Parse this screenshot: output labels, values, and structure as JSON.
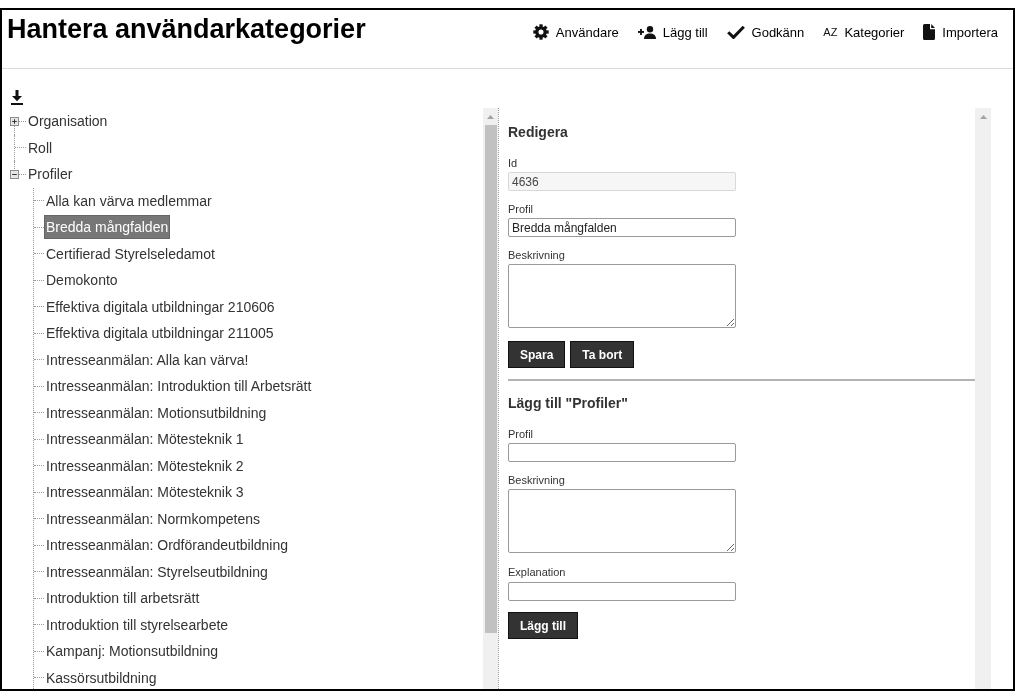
{
  "header": {
    "title": "Hantera användarkategorier",
    "toolbar": [
      {
        "label": "Användare"
      },
      {
        "label": "Lägg till"
      },
      {
        "label": "Godkänn"
      },
      {
        "label": "Kategorier",
        "glyph": "AZ"
      },
      {
        "label": "Importera"
      }
    ]
  },
  "tree": [
    {
      "label": "Organisation",
      "kind": "group",
      "expanded": false,
      "selected": false
    },
    {
      "label": "Roll",
      "kind": "leaf",
      "selected": false
    },
    {
      "label": "Profiler",
      "kind": "group",
      "expanded": true,
      "selected": false,
      "children": [
        {
          "label": "Alla kan värva medlemmar",
          "selected": false
        },
        {
          "label": "Bredda mångfalden",
          "selected": true
        },
        {
          "label": "Certifierad Styrelseledamot",
          "selected": false
        },
        {
          "label": "Demokonto",
          "selected": false
        },
        {
          "label": "Effektiva digitala utbildningar 210606",
          "selected": false
        },
        {
          "label": "Effektiva digitala utbildningar 211005",
          "selected": false
        },
        {
          "label": "Intresseanmälan: Alla kan värva!",
          "selected": false
        },
        {
          "label": "Intresseanmälan: Introduktion till Arbetsrätt",
          "selected": false
        },
        {
          "label": "Intresseanmälan: Motionsutbildning",
          "selected": false
        },
        {
          "label": "Intresseanmälan: Mötesteknik 1",
          "selected": false
        },
        {
          "label": "Intresseanmälan: Mötesteknik 2",
          "selected": false
        },
        {
          "label": "Intresseanmälan: Mötesteknik 3",
          "selected": false
        },
        {
          "label": "Intresseanmälan: Normkompetens",
          "selected": false
        },
        {
          "label": "Intresseanmälan: Ordförandeutbildning",
          "selected": false
        },
        {
          "label": "Intresseanmälan: Styrelseutbildning",
          "selected": false
        },
        {
          "label": "Introduktion till arbetsrätt",
          "selected": false
        },
        {
          "label": "Introduktion till styrelsearbete",
          "selected": false
        },
        {
          "label": "Kampanj: Motionsutbildning",
          "selected": false
        },
        {
          "label": "Kassörsutbildning",
          "selected": false
        }
      ]
    }
  ],
  "edit_form": {
    "title": "Redigera",
    "fields": [
      {
        "label": "Id",
        "kind": "readonly",
        "value": "4636"
      },
      {
        "label": "Profil",
        "kind": "text",
        "value": "Bredda mångfalden"
      },
      {
        "label": "Beskrivning",
        "kind": "textarea"
      }
    ],
    "buttons": [
      "Spara",
      "Ta bort"
    ]
  },
  "add_form": {
    "title": "Lägg till \"Profiler\"",
    "fields": [
      {
        "label": "Profil",
        "kind": "text"
      },
      {
        "label": "Beskrivning",
        "kind": "textarea"
      },
      {
        "label": "Explanation",
        "kind": "text"
      }
    ],
    "buttons": [
      "Lägg till"
    ]
  }
}
